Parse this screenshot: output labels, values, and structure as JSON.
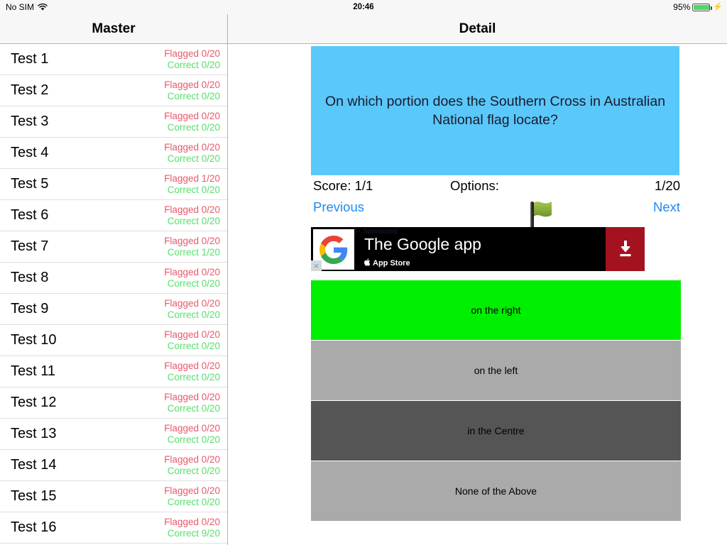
{
  "statusbar": {
    "carrier": "No SIM",
    "wifi_icon": "wifi-icon",
    "time": "20:46",
    "battery_percent": "95%",
    "battery_level": 95,
    "charging_icon": "lightning-bolt-icon"
  },
  "master": {
    "title": "Master",
    "rows": [
      {
        "title": "Test 1",
        "flagged": "Flagged 0/20",
        "correct": "Correct 0/20"
      },
      {
        "title": "Test 2",
        "flagged": "Flagged 0/20",
        "correct": "Correct 0/20"
      },
      {
        "title": "Test 3",
        "flagged": "Flagged 0/20",
        "correct": "Correct 0/20"
      },
      {
        "title": "Test 4",
        "flagged": "Flagged 0/20",
        "correct": "Correct 0/20"
      },
      {
        "title": "Test 5",
        "flagged": "Flagged 1/20",
        "correct": "Correct 0/20"
      },
      {
        "title": "Test 6",
        "flagged": "Flagged 0/20",
        "correct": "Correct 0/20"
      },
      {
        "title": "Test 7",
        "flagged": "Flagged 0/20",
        "correct": "Correct 1/20"
      },
      {
        "title": "Test 8",
        "flagged": "Flagged 0/20",
        "correct": "Correct 0/20"
      },
      {
        "title": "Test 9",
        "flagged": "Flagged 0/20",
        "correct": "Correct 0/20"
      },
      {
        "title": "Test 10",
        "flagged": "Flagged 0/20",
        "correct": "Correct 0/20"
      },
      {
        "title": "Test 11",
        "flagged": "Flagged 0/20",
        "correct": "Correct 0/20"
      },
      {
        "title": "Test 12",
        "flagged": "Flagged 0/20",
        "correct": "Correct 0/20"
      },
      {
        "title": "Test 13",
        "flagged": "Flagged 0/20",
        "correct": "Correct 0/20"
      },
      {
        "title": "Test 14",
        "flagged": "Flagged 0/20",
        "correct": "Correct 0/20"
      },
      {
        "title": "Test 15",
        "flagged": "Flagged 0/20",
        "correct": "Correct 0/20"
      },
      {
        "title": "Test 16",
        "flagged": "Flagged 0/20",
        "correct": "Correct 9/20"
      }
    ]
  },
  "detail": {
    "title": "Detail",
    "question": "On which portion does the Southern Cross in Australian National flag locate?",
    "score": "Score: 1/1",
    "options_label": "Options:",
    "question_index": "1/20",
    "previous_label": "Previous",
    "next_label": "Next",
    "flag_icon": "green-flag-icon",
    "ad": {
      "tiny_text": "Ad · Sponsored",
      "logo": "google-g-logo",
      "headline": "The Google app",
      "store": "App Store",
      "apple_glyph": "",
      "cta_icon": "download-icon",
      "close_icon": "×"
    },
    "options": [
      {
        "label": "on the right",
        "color": "#00ef00"
      },
      {
        "label": "on the left",
        "color": "#aaaaaa"
      },
      {
        "label": "in the Centre",
        "color": "#555555"
      },
      {
        "label": "None of the Above",
        "color": "#aaaaaa"
      }
    ]
  },
  "colors": {
    "question_bg": "#5ac8fa",
    "link": "#1e8bf0",
    "flagged": "#e8596a",
    "correct": "#55e06a",
    "navbar_bg": "#f7f7f7"
  }
}
